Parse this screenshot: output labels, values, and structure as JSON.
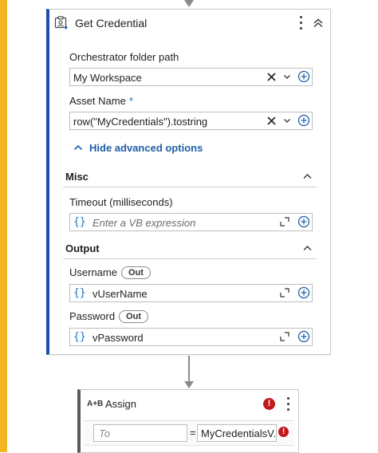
{
  "activity": {
    "title": "Get Credential",
    "icon": "credential-icon",
    "fields": {
      "folder_path": {
        "label": "Orchestrator folder path",
        "value": "My Workspace"
      },
      "asset_name": {
        "label": "Asset Name",
        "required_mark": "*",
        "value": "row(\"MyCredentials\").tostring"
      }
    },
    "advanced_toggle": "Hide advanced options",
    "sections": {
      "misc": {
        "title": "Misc",
        "timeout": {
          "label": "Timeout (milliseconds)",
          "placeholder": "Enter a VB expression"
        }
      },
      "output": {
        "title": "Output",
        "username": {
          "label": "Username",
          "badge": "Out",
          "value": "vUserName"
        },
        "password": {
          "label": "Password",
          "badge": "Out",
          "value": "vPassword"
        }
      }
    }
  },
  "assign": {
    "icon_text": "A+B",
    "title": "Assign",
    "error_badge": "!",
    "to_placeholder": "To",
    "equals": "=",
    "value": "MyCredentialsV..."
  },
  "colors": {
    "accent": "#1f4bb3",
    "link": "#1f5fa8",
    "brace": "#1b6fc9",
    "left_bar": "#f4b321",
    "error": "#c21919"
  },
  "icons": {
    "more": "kebab-vertical-icon",
    "collapse": "double-chevron-up-icon",
    "clear": "close-icon",
    "dropdown": "chevron-down-icon",
    "add": "plus-circle-icon",
    "expand": "expand-icon",
    "expression": "curly-braces-icon"
  }
}
